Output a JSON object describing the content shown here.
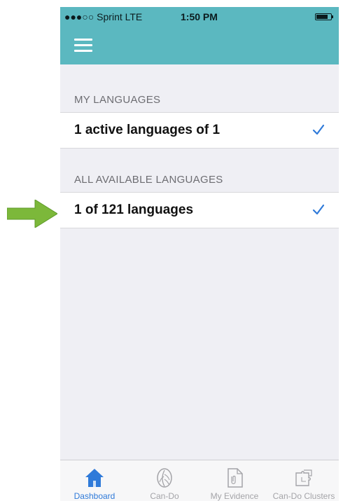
{
  "status_bar": {
    "carrier": "●●●○○ Sprint  LTE",
    "time": "1:50 PM",
    "battery_icon": "battery-icon"
  },
  "nav_bar": {
    "menu_icon": "hamburger-menu-icon",
    "color": "#5bb8c0"
  },
  "sections": [
    {
      "header": "MY LANGUAGES",
      "row_label": "1 active languages of 1",
      "checked": true
    },
    {
      "header": "ALL AVAILABLE LANGUAGES",
      "row_label": "1 of 121 languages",
      "checked": true
    }
  ],
  "tab_bar": {
    "tabs": [
      {
        "label": "Dashboard",
        "icon": "home-icon",
        "active": true
      },
      {
        "label": "Can-Do",
        "icon": "leaf-icon",
        "active": false
      },
      {
        "label": "My Evidence",
        "icon": "document-icon",
        "active": false
      },
      {
        "label": "Can-Do Clusters",
        "icon": "puzzle-icon",
        "active": false
      }
    ],
    "active_color": "#2f7ad9",
    "inactive_color": "#a4a4a8"
  },
  "annotation": {
    "arrow_color": "#7cb83a",
    "arrow_icon": "green-arrow-icon"
  },
  "accent_color": "#2f7ad9"
}
